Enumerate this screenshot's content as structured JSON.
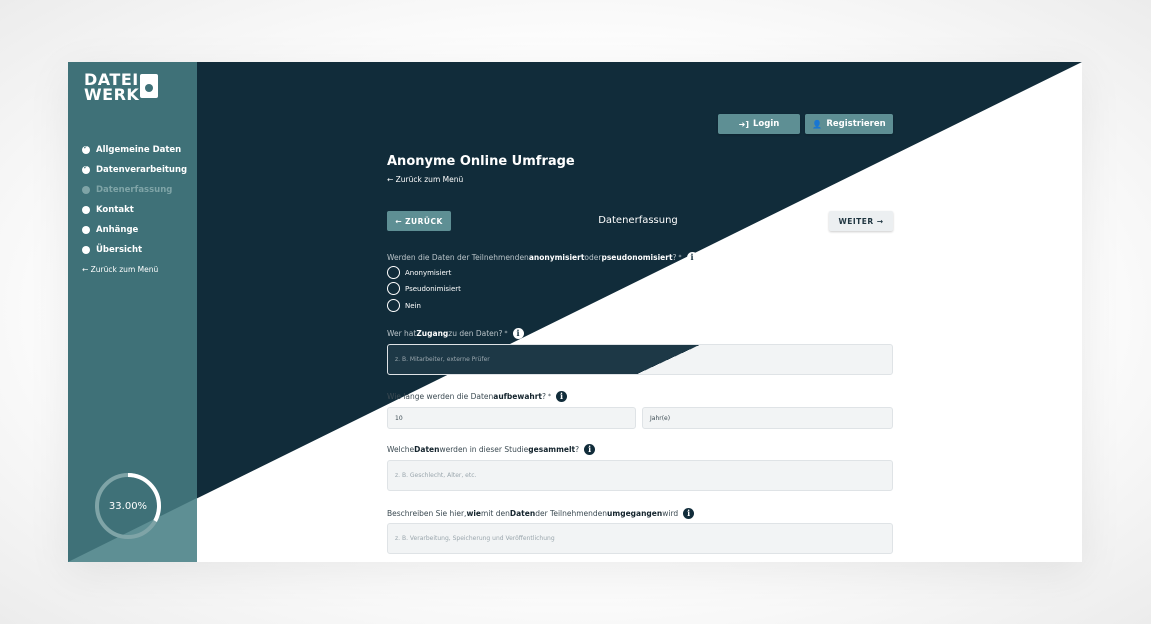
{
  "app": {
    "logo_line1": "DATEI",
    "logo_line2": "WERK"
  },
  "sidebar": {
    "items": [
      {
        "label": "Allgemeine Daten",
        "state": "done"
      },
      {
        "label": "Datenverarbeitung",
        "state": "done"
      },
      {
        "label": "Datenerfassung",
        "state": "current"
      },
      {
        "label": "Kontakt",
        "state": "open"
      },
      {
        "label": "Anhänge",
        "state": "open"
      },
      {
        "label": "Übersicht",
        "state": "open"
      }
    ],
    "back_link": "← Zurück zum Menü",
    "progress_label": "33.00%",
    "progress_value": 0.33
  },
  "header": {
    "login_label": "Login",
    "register_label": "Registrieren"
  },
  "main": {
    "title": "Anonyme Online Umfrage",
    "back_link": "← Zurück zum Menü",
    "back_button": "← ZURÜCK",
    "step_title": "Datenerfassung",
    "next_button": "WEITER →"
  },
  "form": {
    "q1_pre": "Werden die Daten der Teilnehmenden ",
    "q1_b1": "anonymisiert",
    "q1_mid": " oder ",
    "q1_b2": "pseudonomisiert",
    "q1_post": "?",
    "q1_options": [
      "Anonymisiert",
      "Pseudonimisiert",
      "Nein"
    ],
    "q2_pre": "Wer hat ",
    "q2_b": "Zugang",
    "q2_post": " zu den Daten?",
    "q2_placeholder": "z. B. Mitarbeiter, externe Prüfer",
    "q3_pre": "Wie lange werden die Daten ",
    "q3_b": "aufbewahrt",
    "q3_post": "?",
    "q3_value": "10",
    "q3_unit": "Jahr(e)",
    "q4_pre": "Welche ",
    "q4_b1": "Daten",
    "q4_mid": " werden in dieser Studie ",
    "q4_b2": "gesammelt",
    "q4_post": "?",
    "q4_placeholder": "z. B. Geschlecht, Alter, etc.",
    "q5_pre": "Beschreiben Sie hier, ",
    "q5_b1": "wie",
    "q5_mid1": " mit den ",
    "q5_b2": "Daten",
    "q5_mid2": " der Teilnehmenden ",
    "q5_b3": "umgegangen",
    "q5_post": " wird",
    "q5_placeholder": "z. B. Verarbeitung, Speicherung und Veröffentlichung",
    "required_mark": "*",
    "info_glyph": "i"
  }
}
